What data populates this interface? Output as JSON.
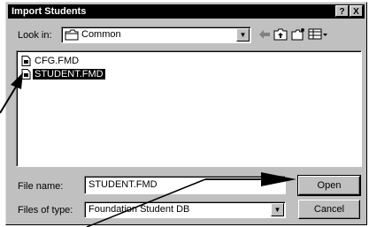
{
  "window": {
    "title": "Import Students",
    "help_label": "?",
    "close_label": "X"
  },
  "look_in": {
    "label": "Look in:",
    "value": "Common"
  },
  "files": [
    {
      "name": "CFG.FMD",
      "selected": false
    },
    {
      "name": "STUDENT.FMD",
      "selected": true
    }
  ],
  "file_name": {
    "label": "File name:",
    "value": "STUDENT.FMD"
  },
  "file_type": {
    "label": "Files of type:",
    "value": "Foundation Student DB"
  },
  "buttons": {
    "open": "Open",
    "cancel": "Cancel"
  }
}
